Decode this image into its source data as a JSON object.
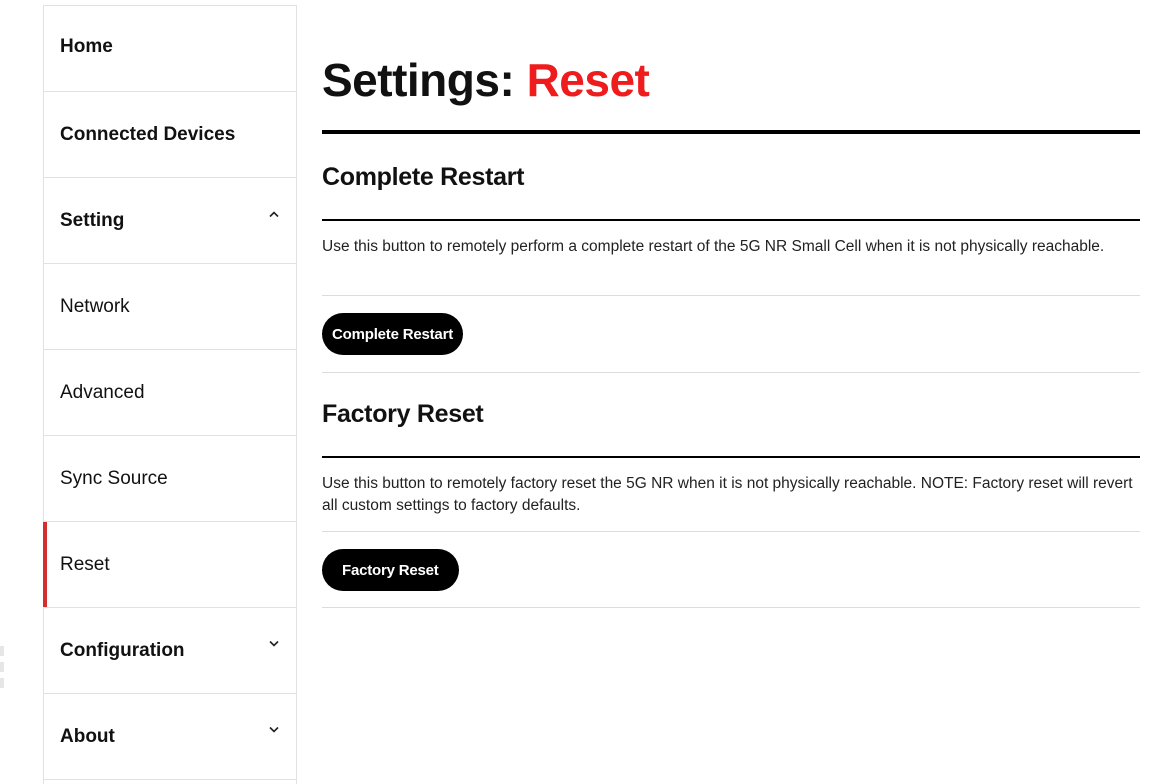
{
  "sidebar": {
    "items": [
      {
        "label": "Home"
      },
      {
        "label": "Connected Devices"
      },
      {
        "label": "Setting",
        "icon": "chevron-up-icon"
      },
      {
        "label": "Network"
      },
      {
        "label": "Advanced"
      },
      {
        "label": "Sync Source"
      },
      {
        "label": "Reset",
        "active": true
      },
      {
        "label": "Configuration",
        "icon": "chevron-down-icon"
      },
      {
        "label": "About",
        "icon": "chevron-down-icon"
      }
    ],
    "active_color": "#d32f2f"
  },
  "main": {
    "title_prefix": "Settings:",
    "title_accent": "Reset",
    "title_accent_color": "#ee1c1c",
    "sections": [
      {
        "heading": "Complete Restart",
        "description": "Use this button to remotely perform a complete restart of the 5G NR Small Cell when it is not physically reachable.",
        "button_label": "Complete Restart"
      },
      {
        "heading": "Factory Reset",
        "description": "Use this button to remotely factory reset the 5G NR when it is not physically reachable. NOTE: Factory reset will revert all custom settings to factory defaults.",
        "button_label": "Factory Reset"
      }
    ]
  }
}
